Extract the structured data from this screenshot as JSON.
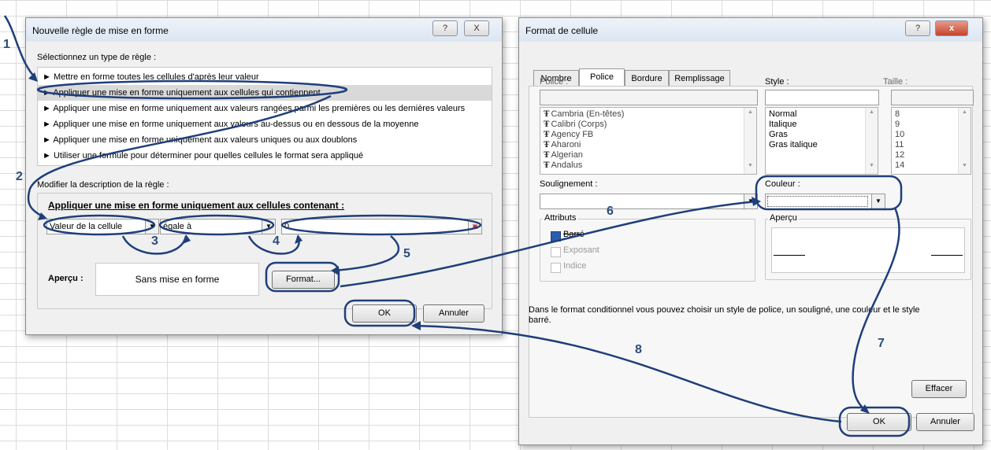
{
  "dialog1": {
    "title": "Nouvelle règle de mise en forme",
    "help_button": "?",
    "close_button": "X",
    "select_type_label": "Sélectionnez un type de règle :",
    "rule_types": [
      "► Mettre en forme toutes les cellules d'après leur valeur",
      "► Appliquer une mise en forme uniquement aux cellules qui contiennent",
      "► Appliquer une mise en forme uniquement aux valeurs rangées parmi les premières ou les dernières valeurs",
      "► Appliquer une mise en forme uniquement aux valeurs au-dessus ou en dessous de la moyenne",
      "► Appliquer une mise en forme uniquement aux valeurs uniques ou aux doublons",
      "► Utiliser une formule pour déterminer pour quelles cellules le format sera appliqué"
    ],
    "selected_rule_index": 1,
    "edit_desc_label": "Modifier la description de la règle :",
    "apply_heading": "Appliquer une mise en forme uniquement aux cellules contenant :",
    "condition_field": "Valeur de la cellule",
    "operator_field": "égale à",
    "value_field": "0",
    "preview_label": "Aperçu :",
    "preview_text": "Sans mise en forme",
    "format_button": "Format...",
    "ok_button": "OK",
    "cancel_button": "Annuler"
  },
  "dialog2": {
    "title": "Format de cellule",
    "help_button": "?",
    "close_button": "x",
    "tabs": [
      "Nombre",
      "Police",
      "Bordure",
      "Remplissage"
    ],
    "active_tab_index": 1,
    "font_label": "Police :",
    "style_label": "Style :",
    "size_label": "Taille :",
    "fonts": [
      "Cambria (En-têtes)",
      "Calibri (Corps)",
      "Agency FB",
      "Aharoni",
      "Algerian",
      "Andalus"
    ],
    "styles": [
      "Normal",
      "Italique",
      "Gras",
      "Gras italique"
    ],
    "sizes": [
      "8",
      "9",
      "10",
      "11",
      "12",
      "14"
    ],
    "underline_label": "Soulignement :",
    "color_label": "Couleur :",
    "attributes_label": "Attributs",
    "attributes": [
      {
        "label": "Barré",
        "checked": true
      },
      {
        "label": "Exposant",
        "checked": false
      },
      {
        "label": "Indice",
        "checked": false
      }
    ],
    "preview_label": "Aperçu",
    "info_text_line1": "Dans le format conditionnel vous pouvez choisir un style de police, un souligné, une couleur et le style",
    "info_text_line2": "barré.",
    "clear_button": "Effacer",
    "ok_button": "OK",
    "cancel_button": "Annuler"
  },
  "annotations": [
    "1",
    "2",
    "3",
    "4",
    "5",
    "6",
    "7",
    "8"
  ],
  "colors": {
    "annotation": "#1f3f7a",
    "selection": "#d9d9d9",
    "checked": "#2a5db0"
  }
}
